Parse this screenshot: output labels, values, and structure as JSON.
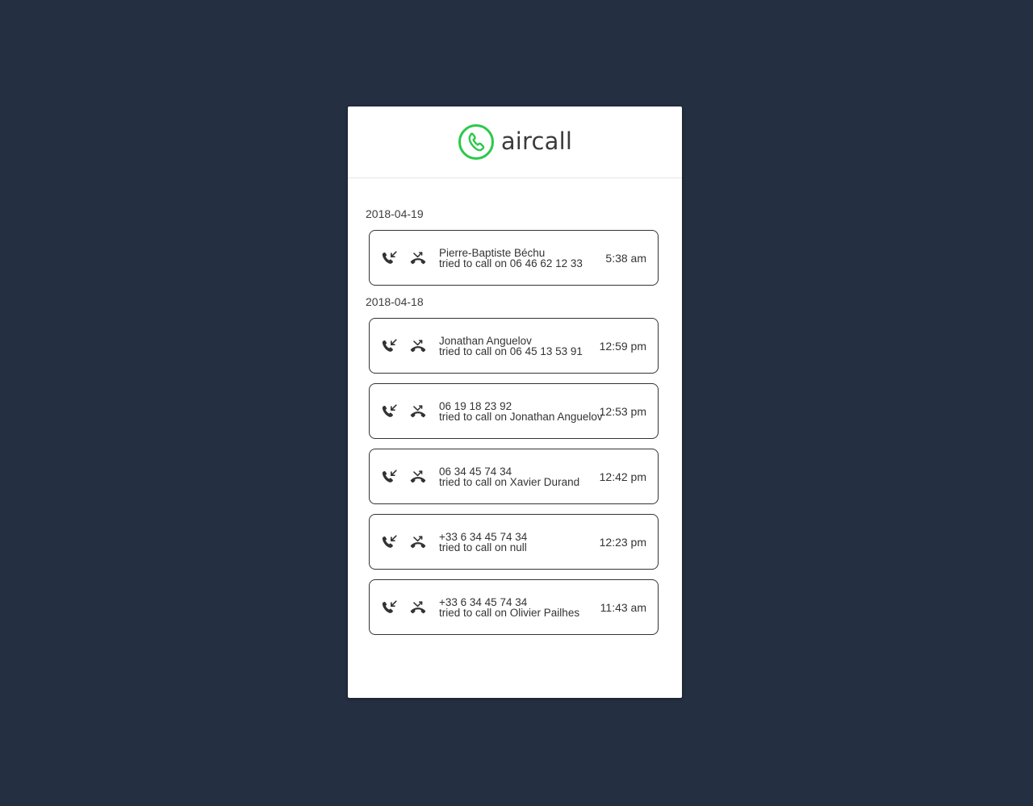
{
  "brand": {
    "name": "aircall",
    "color": "#2ac94a"
  },
  "colors": {
    "background": "#242f41",
    "panel": "#ffffff",
    "card_border": "#333333"
  },
  "groups": [
    {
      "date": "2018-04-19",
      "calls": [
        {
          "direction_icon": "inbound-call-icon",
          "status_icon": "missed-call-icon",
          "contact": "Pierre-Baptiste Béchu",
          "detail": "tried to call on 06 46 62 12 33",
          "time": "5:38 am"
        }
      ]
    },
    {
      "date": "2018-04-18",
      "calls": [
        {
          "direction_icon": "inbound-call-icon",
          "status_icon": "missed-call-icon",
          "contact": "Jonathan Anguelov",
          "detail": "tried to call on 06 45 13 53 91",
          "time": "12:59 pm"
        },
        {
          "direction_icon": "inbound-call-icon",
          "status_icon": "missed-call-icon",
          "contact": "06 19 18 23 92",
          "detail": "tried to call on Jonathan Anguelov",
          "time": "12:53 pm"
        },
        {
          "direction_icon": "inbound-call-icon",
          "status_icon": "missed-call-icon",
          "contact": "06 34 45 74 34",
          "detail": "tried to call on Xavier Durand",
          "time": "12:42 pm"
        },
        {
          "direction_icon": "inbound-call-icon",
          "status_icon": "missed-call-icon",
          "contact": "+33 6 34 45 74 34",
          "detail": "tried to call on null",
          "time": "12:23 pm"
        },
        {
          "direction_icon": "inbound-call-icon",
          "status_icon": "missed-call-icon",
          "contact": "+33 6 34 45 74 34",
          "detail": "tried to call on Olivier Pailhes",
          "time": "11:43 am"
        }
      ]
    }
  ]
}
